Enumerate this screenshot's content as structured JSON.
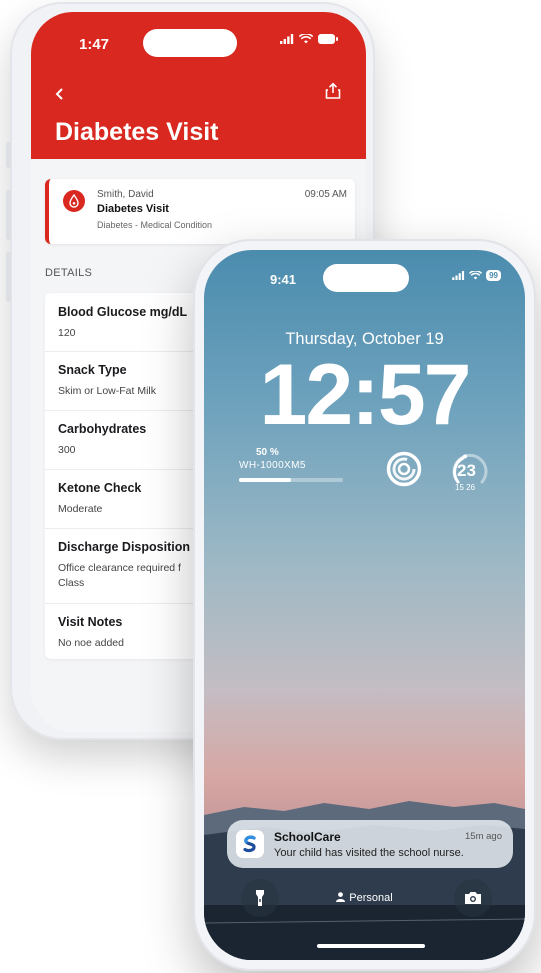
{
  "back_phone": {
    "status_time": "1:47",
    "title": "Diabetes Visit",
    "visit": {
      "patient": "Smith, David",
      "time": "09:05 AM",
      "title": "Diabetes Visit",
      "subtitle": "Diabetes - Medical Condition"
    },
    "details_label": "DETAILS",
    "details": [
      {
        "label": "Blood Glucose mg/dL",
        "value": "120"
      },
      {
        "label": "Snack Type",
        "value": "Skim or Low-Fat Milk"
      },
      {
        "label": "Carbohydrates",
        "value": "300"
      },
      {
        "label": "Ketone Check",
        "value": "Moderate"
      },
      {
        "label": "Discharge Disposition",
        "value": "Office clearance required f Class"
      },
      {
        "label": "Visit Notes",
        "value": "No noe added"
      }
    ],
    "accent_color": "#d9281f"
  },
  "front_phone": {
    "status_time": "9:41",
    "battery_text": "99",
    "date": "Thursday, October 19",
    "clock": "12:57",
    "widgets": {
      "headphone_percent": "50 %",
      "headphone_level": 0.5,
      "headphone_device": "WH-1000XM5",
      "temperature": "23",
      "temp_range": "15  26"
    },
    "notification": {
      "app": "SchoolCare",
      "when": "15m ago",
      "message": "Your child has visited the school nurse."
    },
    "focus_label": "Personal",
    "icons": {
      "left": "flashlight-icon",
      "right": "camera-icon"
    }
  }
}
